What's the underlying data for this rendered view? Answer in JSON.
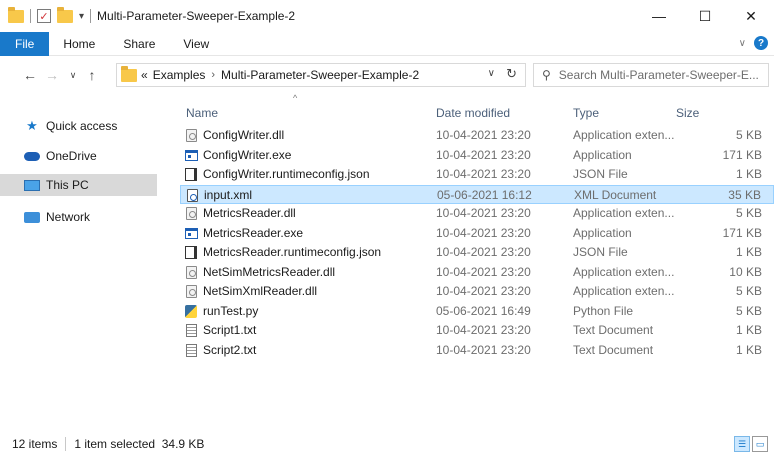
{
  "window": {
    "title": "Multi-Parameter-Sweeper-Example-2",
    "controls": {
      "minimize": "—",
      "maximize": "☐",
      "close": "✕"
    }
  },
  "ribbon": {
    "tabs": [
      "File",
      "Home",
      "Share",
      "View"
    ],
    "help": "?"
  },
  "address": {
    "overflow": "«",
    "crumbs": [
      "Examples",
      "Multi-Parameter-Sweeper-Example-2"
    ],
    "separator": "›",
    "search_placeholder": "Search Multi-Parameter-Sweeper-E..."
  },
  "nav": {
    "items": [
      {
        "label": "Quick access",
        "icon": "star-icon"
      },
      {
        "label": "OneDrive",
        "icon": "cloud-icon"
      },
      {
        "label": "This PC",
        "icon": "computer-icon"
      },
      {
        "label": "Network",
        "icon": "network-icon"
      }
    ]
  },
  "columns": {
    "name": "Name",
    "date": "Date modified",
    "type": "Type",
    "size": "Size"
  },
  "files": [
    {
      "name": "ConfigWriter.dll",
      "date": "10-04-2021 23:20",
      "type": "Application exten...",
      "size": "5 KB",
      "icon": "dll"
    },
    {
      "name": "ConfigWriter.exe",
      "date": "10-04-2021 23:20",
      "type": "Application",
      "size": "171 KB",
      "icon": "exe"
    },
    {
      "name": "ConfigWriter.runtimeconfig.json",
      "date": "10-04-2021 23:20",
      "type": "JSON File",
      "size": "1 KB",
      "icon": "json"
    },
    {
      "name": "input.xml",
      "date": "05-06-2021 16:12",
      "type": "XML Document",
      "size": "35 KB",
      "icon": "xml"
    },
    {
      "name": "MetricsReader.dll",
      "date": "10-04-2021 23:20",
      "type": "Application exten...",
      "size": "5 KB",
      "icon": "dll"
    },
    {
      "name": "MetricsReader.exe",
      "date": "10-04-2021 23:20",
      "type": "Application",
      "size": "171 KB",
      "icon": "exe"
    },
    {
      "name": "MetricsReader.runtimeconfig.json",
      "date": "10-04-2021 23:20",
      "type": "JSON File",
      "size": "1 KB",
      "icon": "json"
    },
    {
      "name": "NetSimMetricsReader.dll",
      "date": "10-04-2021 23:20",
      "type": "Application exten...",
      "size": "10 KB",
      "icon": "dll"
    },
    {
      "name": "NetSimXmlReader.dll",
      "date": "10-04-2021 23:20",
      "type": "Application exten...",
      "size": "5 KB",
      "icon": "dll"
    },
    {
      "name": "runTest.py",
      "date": "05-06-2021 16:49",
      "type": "Python File",
      "size": "5 KB",
      "icon": "py"
    },
    {
      "name": "Script1.txt",
      "date": "10-04-2021 23:20",
      "type": "Text Document",
      "size": "1 KB",
      "icon": "txt"
    },
    {
      "name": "Script2.txt",
      "date": "10-04-2021 23:20",
      "type": "Text Document",
      "size": "1 KB",
      "icon": "txt"
    }
  ],
  "status": {
    "count": "12 items",
    "selection": "1 item selected  34.9 KB"
  },
  "colors": {
    "accent": "#1979ca",
    "selection": "#cce8ff",
    "folder": "#f8c84a"
  }
}
